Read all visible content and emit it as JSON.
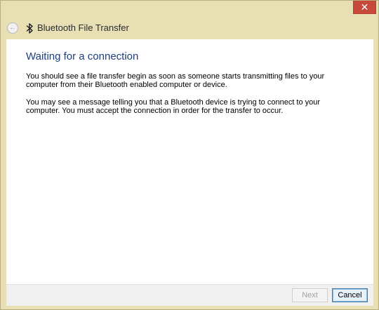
{
  "window": {
    "title": "Bluetooth File Transfer",
    "close_glyph": "✕",
    "back_glyph": "←",
    "frame_color": "#e8dfb4",
    "close_color": "#c7493a"
  },
  "icons": {
    "close": "close-icon",
    "back": "back-arrow-icon",
    "app": "bluetooth-icon"
  },
  "main": {
    "heading": "Waiting for a connection",
    "heading_color": "#1e3f7a",
    "paragraph_1": "You should see a file transfer begin as soon as someone starts transmitting files to your computer from their Bluetooth enabled computer or device.",
    "paragraph_2": "You may see a message telling you that a Bluetooth device is trying to connect to your computer. You must accept the connection in order for the transfer to occur."
  },
  "footer": {
    "next_label": "Next",
    "next_enabled": false,
    "cancel_label": "Cancel"
  }
}
